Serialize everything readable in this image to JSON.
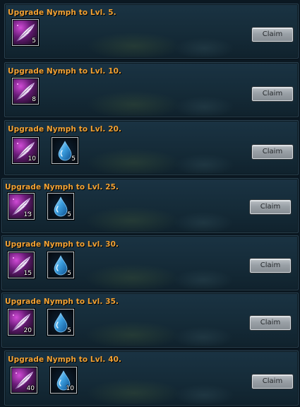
{
  "colors": {
    "title": "#f3a233",
    "background": "#0b1822",
    "panel": "#152b38",
    "button": "#9aa1a7"
  },
  "icons": {
    "feather": "pink-feather-icon",
    "water": "water-drop-icon"
  },
  "quests": [
    {
      "title": "Upgrade Nymph to Lvl. 5.",
      "rewards": [
        {
          "item": "feather-item",
          "qty": "5"
        }
      ],
      "claim_label": "Claim"
    },
    {
      "title": "Upgrade Nymph to Lvl. 10.",
      "rewards": [
        {
          "item": "feather-item",
          "qty": "8"
        }
      ],
      "claim_label": "Claim"
    },
    {
      "title": "Upgrade Nymph to Lvl. 20.",
      "rewards": [
        {
          "item": "feather-item",
          "qty": "10"
        },
        {
          "item": "water-drop-item",
          "qty": "5"
        }
      ],
      "claim_label": "Claim"
    },
    {
      "title": "Upgrade Nymph to Lvl. 25.",
      "rewards": [
        {
          "item": "feather-item",
          "qty": "13"
        },
        {
          "item": "water-drop-item",
          "qty": "5"
        }
      ],
      "claim_label": "Claim"
    },
    {
      "title": "Upgrade Nymph to Lvl. 30.",
      "rewards": [
        {
          "item": "feather-item",
          "qty": "15"
        },
        {
          "item": "water-drop-item",
          "qty": "5"
        }
      ],
      "claim_label": "Claim"
    },
    {
      "title": "Upgrade Nymph to Lvl. 35.",
      "rewards": [
        {
          "item": "feather-item",
          "qty": "20"
        },
        {
          "item": "water-drop-item",
          "qty": "5"
        }
      ],
      "claim_label": "Claim"
    },
    {
      "title": "Upgrade Nymph to Lvl. 40.",
      "rewards": [
        {
          "item": "feather-item",
          "qty": "40"
        },
        {
          "item": "water-drop-item",
          "qty": "10"
        }
      ],
      "claim_label": "Claim"
    }
  ]
}
